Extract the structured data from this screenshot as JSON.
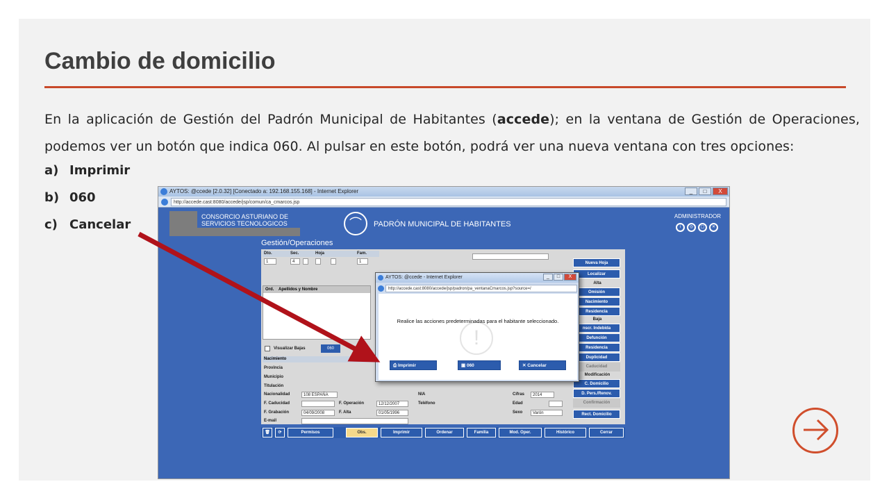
{
  "slide": {
    "title": "Cambio de domicilio",
    "paragraph_before": "En la aplicación de Gestión del Padrón Municipal de Habitantes (",
    "paragraph_bold": "accede",
    "paragraph_after": "); en la ventana de Gestión de Operaciones, podemos ver un botón que indica 060. Al pulsar en este botón, podrá ver una nueva ventana con tres opciones:",
    "options": [
      {
        "letter": "a)",
        "label": "Imprimir"
      },
      {
        "letter": "b)",
        "label": "060"
      },
      {
        "letter": "c)",
        "label": "Cancelar"
      }
    ],
    "next_icon": "arrow-right-circle-icon",
    "accent_color": "#c8492a"
  },
  "ie": {
    "title": "AYTOS: @ccede [2.0.32] [Conectado a: 192.168.155.168] - Internet Explorer",
    "url": "http://accede.cast:8080/accede/jsp/comun/ca_cmarcos.jsp",
    "min": "_",
    "max": "□",
    "close": "X"
  },
  "app": {
    "org": "CONSORCIO ASTURIANO DE SERVICIOS TECNOLOGICOS",
    "logo": "⌒",
    "product": "PADRÓN MUNICIPAL DE HABITANTES",
    "user": "ADMINISTRADOR",
    "admin_icons": [
      "i",
      "◎",
      "▢",
      "✕"
    ],
    "section": "Gestión/Operaciones",
    "fields": {
      "dto": "Dto.",
      "dto_val": "1",
      "sec": "Sec.",
      "sec_val": "4",
      "hoja": "Hoja",
      "fam": "Fam.",
      "fam_val": "1",
      "ord": "Ord.",
      "apellidos": "Apellidos y Nombre",
      "visualizar": "Visualizar Bajas",
      "btn_060": "060",
      "nacimiento": "Nacimiento",
      "provincia": "Provincia",
      "municipio": "Municipio",
      "titulacion": "Titulación",
      "nacionalidad": "Nacionalidad",
      "nacionalidad_val": "108  ESPAÑA",
      "f_caducidad": "F. Caducidad",
      "f_operacion": "F. Operación",
      "f_operacion_val": "12/12/2007",
      "f_grabacion": "F. Grabación",
      "f_grabacion_val": "04/09/2008",
      "f_alta": "F. Alta",
      "f_alta_val": "01/05/1996",
      "email": "E-mail",
      "nia": "NIA",
      "telefono": "Teléfono",
      "cifras": "Cifras",
      "cifras_val": "2014",
      "edad": "Edad",
      "sexo": "Sexo",
      "sexo_val": "Varón"
    },
    "right_buttons": {
      "nueva_hoja": "Nueva Hoja",
      "localizar": "Localizar",
      "alta": "Alta",
      "omision": "Omisión",
      "nacimiento": "Nacimiento",
      "residencia": "Residencia",
      "baja": "Baja",
      "inscr_indebida": "nscr. Indebida",
      "defuncion": "Defunción",
      "residencia2": "Residencia",
      "duplicidad": "Duplicidad",
      "caducidad": "Caducidad",
      "modificacion": "Modificación",
      "c_domicilio": "C. Domicilio",
      "d_pers": "D. Pers./Renov.",
      "confirmacion": "Confirmación",
      "rect_domicilio": "Rect. Domicilio"
    },
    "bottom_buttons": {
      "permisos": "Permisos",
      "obs": "Obs.",
      "imprimir": "Imprimir",
      "ordenar": "Ordenar",
      "familia": "Familia",
      "mod_oper": "Mod. Oper.",
      "historico": "Histórico",
      "cerrar": "Cerrar"
    }
  },
  "dialog": {
    "title": "AYTOS: @ccede - Internet Explorer",
    "url": "http://accede.cast:8080/accede/jsp/padron/pa_ventanaCmarcos.jsp?source=/",
    "message": "Realice las acciones predeterminadas para el habitante seleccionado.",
    "imprimir": "Imprimir",
    "btn_060": "060",
    "cancelar": "Cancelar"
  }
}
